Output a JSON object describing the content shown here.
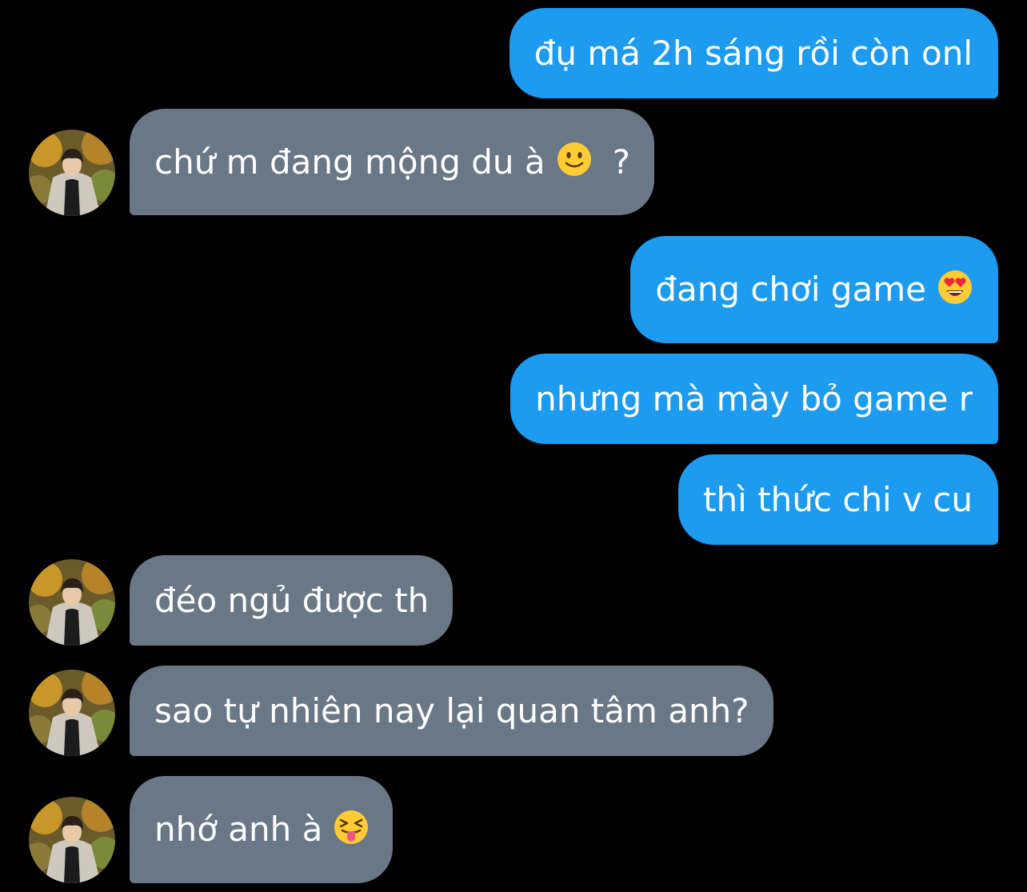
{
  "colors": {
    "background": "#000000",
    "sent_bubble": "#1d9bf0",
    "received_bubble": "#6a7786",
    "text": "#ffffff"
  },
  "messages": [
    {
      "direction": "sent",
      "text": "đụ má 2h sáng rồi còn onl"
    },
    {
      "direction": "received",
      "text": "chứ m đang mộng du à",
      "emoji": "slightly-smiling-face-icon",
      "suffix": "?"
    },
    {
      "direction": "sent",
      "text": "đang chơi game",
      "emoji": "heart-eyes-face-icon"
    },
    {
      "direction": "sent",
      "text": "nhưng mà mày bỏ game r"
    },
    {
      "direction": "sent",
      "text": "thì thức chi v cu"
    },
    {
      "direction": "received",
      "text": "đéo ngủ được th"
    },
    {
      "direction": "received",
      "text": "sao tự nhiên nay lại quan tâm anh?"
    },
    {
      "direction": "received",
      "text": "nhớ anh à",
      "emoji": "squinting-tongue-face-icon"
    }
  ]
}
